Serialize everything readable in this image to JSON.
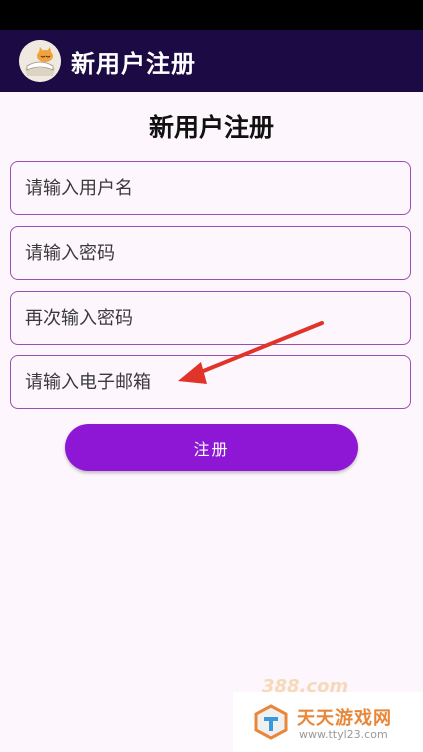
{
  "app_bar": {
    "title": "新用户注册"
  },
  "page": {
    "heading": "新用户注册"
  },
  "form": {
    "username_placeholder": "请输入用户名",
    "password_placeholder": "请输入密码",
    "confirm_password_placeholder": "再次输入密码",
    "email_placeholder": "请输入电子邮箱",
    "submit_label": "注册"
  },
  "watermark": {
    "brand": "天天游戏网",
    "url": "www.ttyl23.com",
    "badge": "388.com"
  },
  "colors": {
    "app_bar": "#1c0a45",
    "accent": "#8e17d6",
    "field_border": "#9a4fb0",
    "annotation_arrow": "#e0342b",
    "background": "#fdf6fc"
  }
}
